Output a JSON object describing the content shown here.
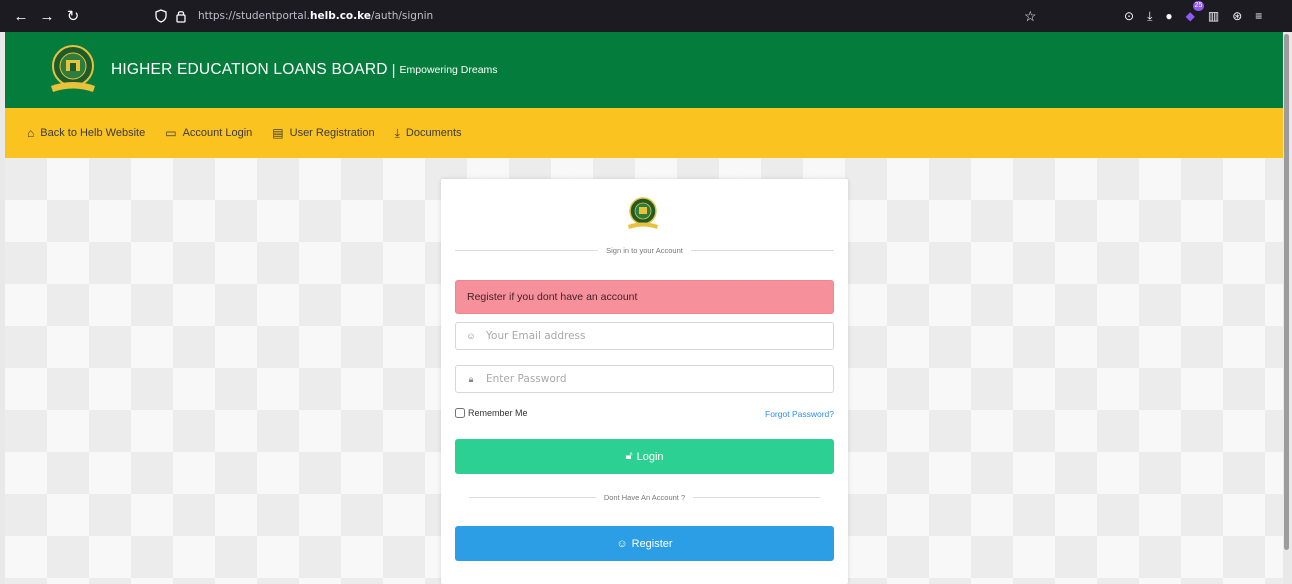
{
  "browser": {
    "url_prefix": "https://studentportal.",
    "url_domain": "helb.co.ke",
    "url_path": "/auth/signin",
    "extension_badge": "25"
  },
  "header": {
    "title": "HIGHER EDUCATION LOANS BOARD",
    "separator": "|",
    "tagline": "Empowering Dreams"
  },
  "nav": {
    "items": [
      {
        "icon": "home-icon",
        "label": "Back to Helb Website"
      },
      {
        "icon": "monitor-icon",
        "label": "Account Login"
      },
      {
        "icon": "document-icon",
        "label": "User Registration"
      },
      {
        "icon": "download-icon",
        "label": "Documents"
      }
    ]
  },
  "login": {
    "signin_heading": "Sign in to your Account",
    "alert_text": "Register if you dont have an account",
    "email_placeholder": "Your Email address",
    "password_placeholder": "Enter Password",
    "remember_label": "Remember Me",
    "forgot_label": "Forgot Password?",
    "login_label": "Login",
    "no_account_text": "Dont Have An Account ?",
    "register_label": "Register"
  },
  "colors": {
    "header_green": "#047d3c",
    "nav_yellow": "#fbc31f",
    "alert_red": "#f6919c",
    "login_green": "#2dd093",
    "register_blue": "#2b9ee5"
  }
}
